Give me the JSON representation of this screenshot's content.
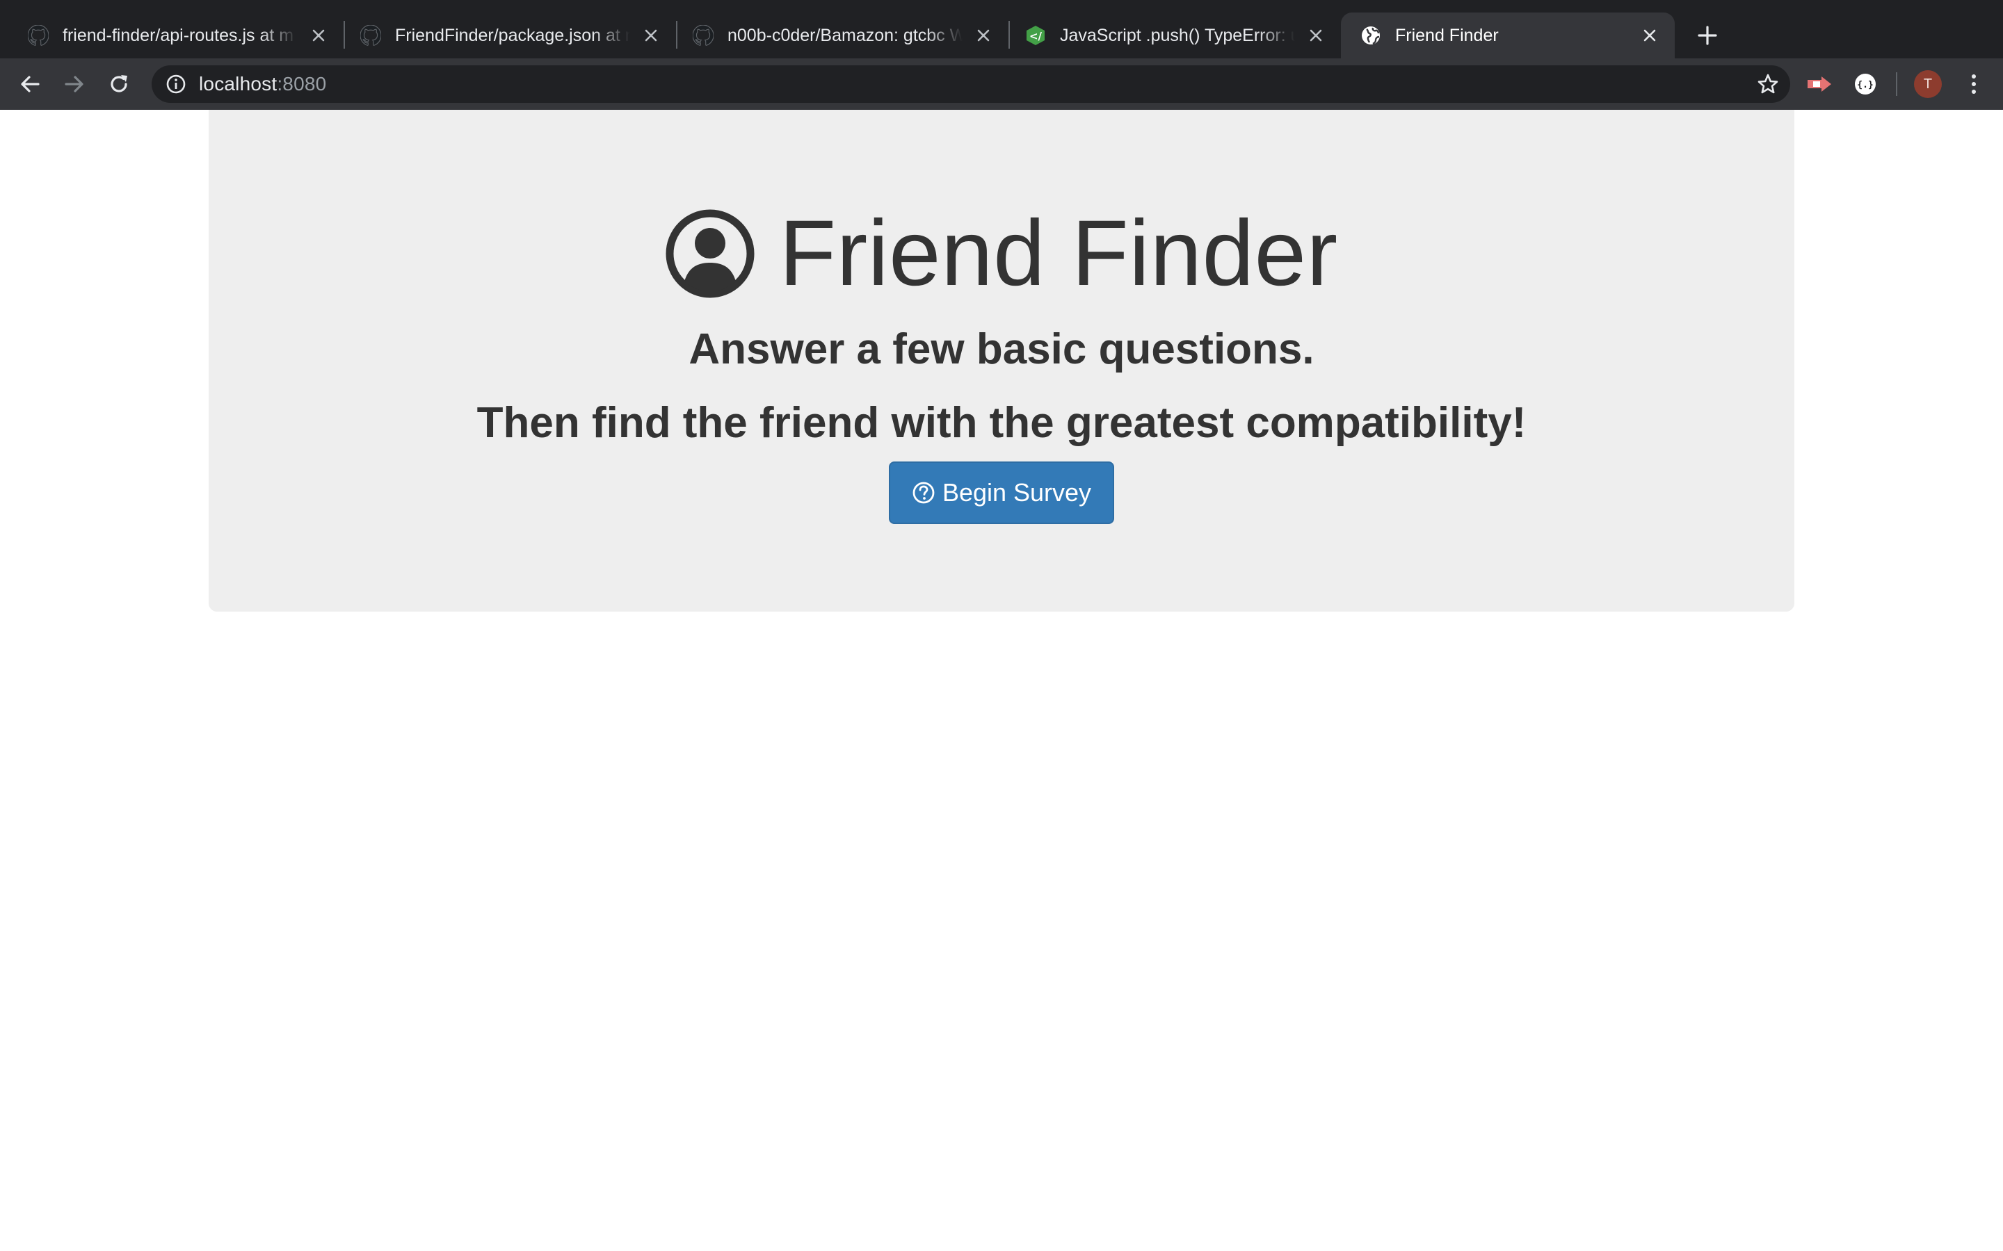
{
  "browser": {
    "tabs": [
      {
        "title": "friend-finder/api-routes.js at m",
        "icon": "github-icon",
        "active": false
      },
      {
        "title": "FriendFinder/package.json at m",
        "icon": "github-icon",
        "active": false
      },
      {
        "title": "n00b-c0der/Bamazon: gtcbc W",
        "icon": "github-icon",
        "active": false
      },
      {
        "title": "JavaScript .push() TypeError: u",
        "icon": "codecademy-icon",
        "active": false
      },
      {
        "title": "Friend Finder",
        "icon": "globe-icon",
        "active": true
      }
    ],
    "address_bar": {
      "host": "localhost",
      "port": ":8080"
    },
    "profile_initial": "T"
  },
  "page": {
    "title": "Friend Finder",
    "lead_line_1": "Answer a few basic questions.",
    "lead_line_2": "Then find the friend with the greatest compatibility!",
    "cta_label": "Begin Survey",
    "colors": {
      "jumbotron_bg": "#eeeeee",
      "text": "#333333",
      "button_primary": "#337ab7"
    }
  }
}
